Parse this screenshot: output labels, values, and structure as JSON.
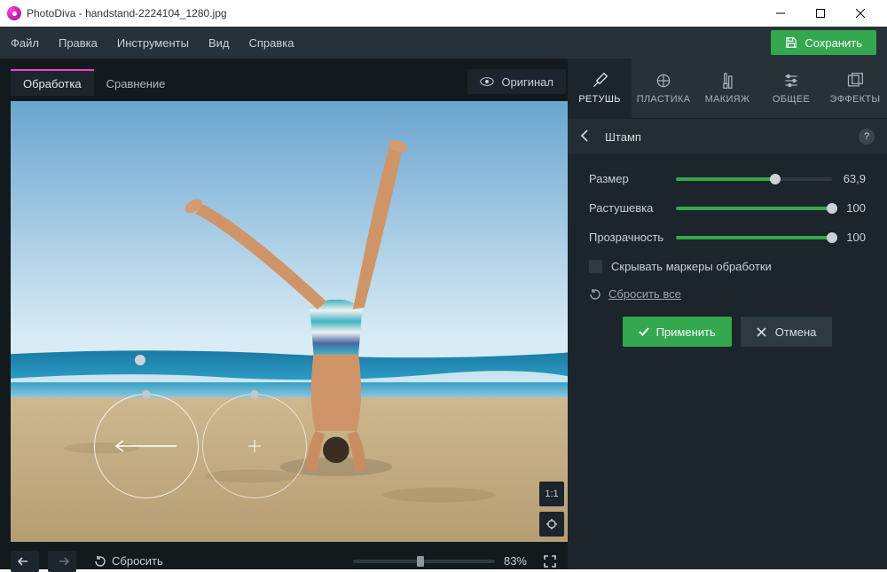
{
  "titlebar": {
    "app": "PhotoDiva",
    "file": "handstand-2224104_1280.jpg"
  },
  "menu": {
    "file": "Файл",
    "edit": "Правка",
    "tools": "Инструменты",
    "view": "Вид",
    "help": "Справка",
    "save": "Сохранить"
  },
  "workspace": {
    "tab_edit": "Обработка",
    "tab_compare": "Сравнение",
    "original_btn": "Оригинал",
    "one_to_one": "1:1",
    "zoom_pct": "83%",
    "reset": "Сбросить"
  },
  "modes": {
    "retouch": "РЕТУШЬ",
    "liquify": "ПЛАСТИКА",
    "makeup": "МАКИЯЖ",
    "general": "ОБЩЕЕ",
    "effects": "ЭФФЕКТЫ"
  },
  "panel": {
    "title": "Штамп",
    "size_label": "Размер",
    "size_value": "63,9",
    "size_pct": 63.9,
    "feather_label": "Растушевка",
    "feather_value": "100",
    "feather_pct": 100,
    "opacity_label": "Прозрачность",
    "opacity_value": "100",
    "opacity_pct": 100,
    "hide_markers": "Скрывать маркеры обработки",
    "reset_all": "Сбросить все",
    "apply": "Применить",
    "cancel": "Отмена"
  }
}
